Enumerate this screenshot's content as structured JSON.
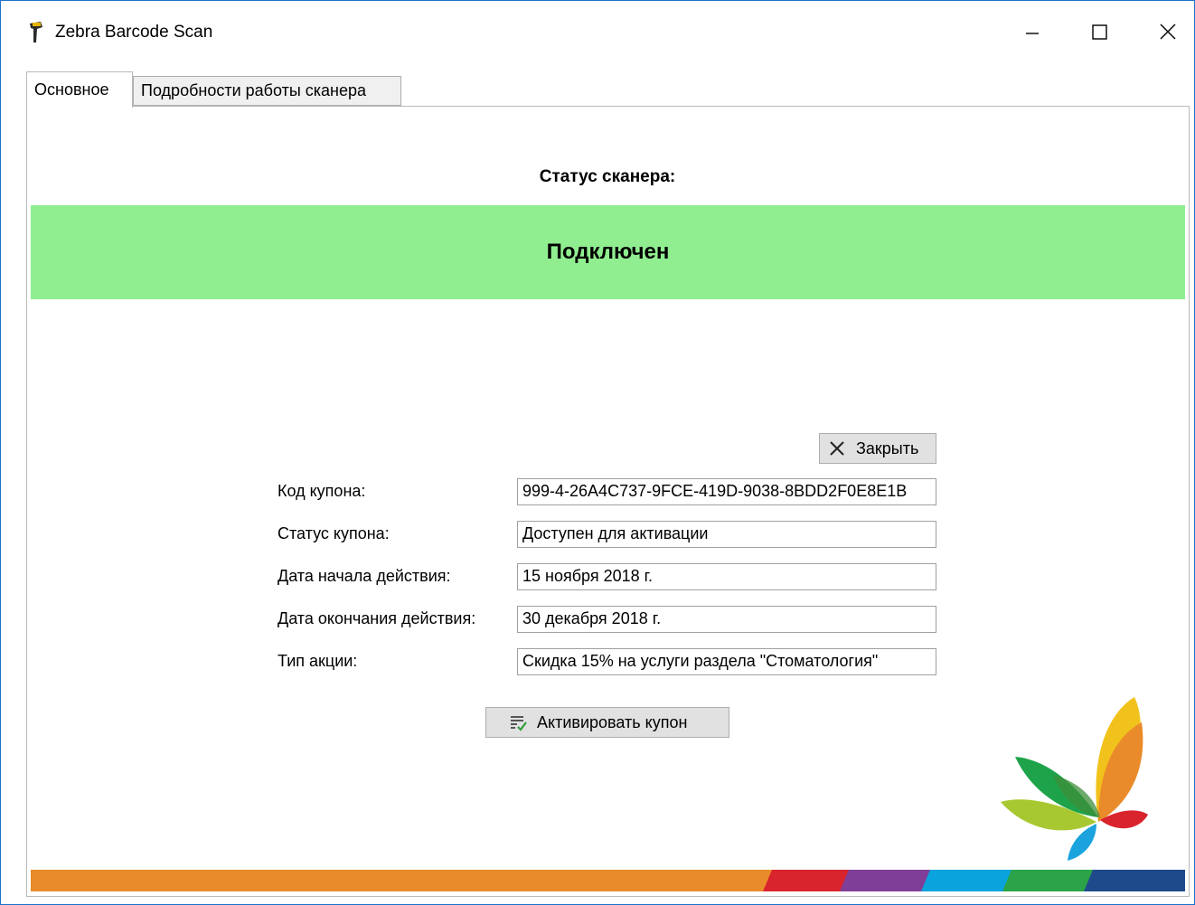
{
  "window": {
    "title": "Zebra Barcode Scan"
  },
  "tabs": [
    {
      "label": "Основное",
      "active": true
    },
    {
      "label": "Подробности работы сканера",
      "active": false
    }
  ],
  "scanner_status": {
    "label": "Статус сканера:",
    "value": "Подключен",
    "color": "#90EE90"
  },
  "close_button": {
    "label": "Закрыть",
    "icon": "close-x-icon"
  },
  "coupon": {
    "fields": [
      {
        "label": "Код купона:",
        "value": "999-4-26A4C737-9FCE-419D-9038-8BDD2F0E8E1B"
      },
      {
        "label": "Статус купона:",
        "value": "Доступен для активации"
      },
      {
        "label": "Дата начала действия:",
        "value": "15 ноября 2018 г."
      },
      {
        "label": "Дата окончания действия:",
        "value": "30 декабря 2018 г."
      },
      {
        "label": "Тип акции:",
        "value": "Скидка 15% на услуги раздела \"Стоматология\""
      }
    ]
  },
  "activate_button": {
    "label": "Активировать купон",
    "icon": "checklist-icon"
  },
  "brand_colors": [
    "#E98B2A",
    "#D9232D",
    "#7F3F98",
    "#0AA3DE",
    "#2BA348",
    "#1E4A8C"
  ]
}
